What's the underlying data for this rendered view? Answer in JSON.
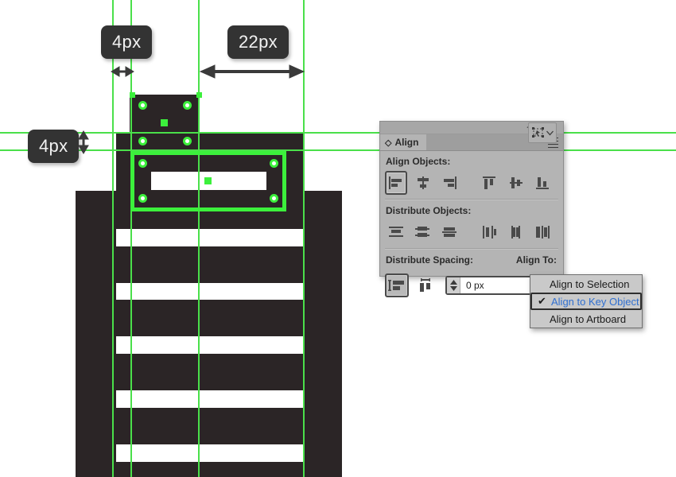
{
  "canvas": {
    "name": "illustrator-artboard",
    "background": "#ffffff",
    "artwork_color": "#2b2526",
    "guide_color": "#4ae04a",
    "selection_color": "#3cf03c"
  },
  "measurements": [
    {
      "id": "m1",
      "label": "4px",
      "orientation": "horizontal"
    },
    {
      "id": "m2",
      "label": "22px",
      "orientation": "horizontal"
    },
    {
      "id": "m3",
      "label": "4px",
      "orientation": "vertical"
    }
  ],
  "panel": {
    "title": "Align",
    "collapse_icon": "double-chevron-left-icon",
    "close_icon": "close-icon",
    "menu_icon": "panel-menu-icon",
    "tab_icon": "align-tab-icon",
    "sections": {
      "align_objects": {
        "label": "Align Objects:",
        "buttons": [
          {
            "name": "horizontal-align-left",
            "selected": true
          },
          {
            "name": "horizontal-align-center",
            "selected": false
          },
          {
            "name": "horizontal-align-right",
            "selected": false
          },
          {
            "name": "vertical-align-top",
            "selected": false
          },
          {
            "name": "vertical-align-center",
            "selected": false
          },
          {
            "name": "vertical-align-bottom",
            "selected": false
          }
        ]
      },
      "distribute_objects": {
        "label": "Distribute Objects:",
        "buttons": [
          {
            "name": "vertical-distribute-top",
            "selected": false
          },
          {
            "name": "vertical-distribute-center",
            "selected": false
          },
          {
            "name": "vertical-distribute-bottom",
            "selected": false
          },
          {
            "name": "horizontal-distribute-left",
            "selected": false
          },
          {
            "name": "horizontal-distribute-center",
            "selected": false
          },
          {
            "name": "horizontal-distribute-right",
            "selected": false
          }
        ]
      },
      "distribute_spacing": {
        "label": "Distribute Spacing:",
        "buttons": [
          {
            "name": "vertical-distribute-space",
            "selected": true
          },
          {
            "name": "horizontal-distribute-space",
            "selected": false
          }
        ],
        "spacing_value": "0 px",
        "spacing_placeholder": "0 px"
      },
      "align_to": {
        "label": "Align To:",
        "selected": "Align to Key Object",
        "button_icon": "align-to-key-object-icon",
        "chevron": "chevron-down-icon"
      }
    }
  },
  "dropdown": {
    "name": "align-to-menu",
    "items": [
      {
        "label": "Align to Selection",
        "checked": false
      },
      {
        "label": "Align to Key Object",
        "checked": true
      },
      {
        "label": "Align to Artboard",
        "checked": false
      }
    ],
    "check_glyph": "✔"
  }
}
